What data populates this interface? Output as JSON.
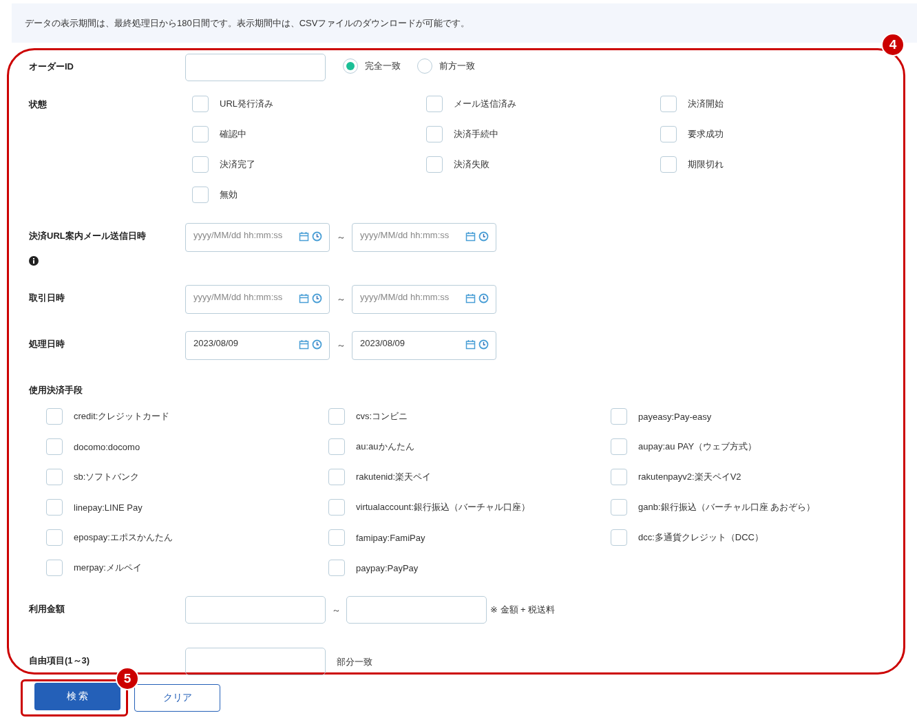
{
  "notice": "データの表示期間は、最終処理日から180日間です。表示期間中は、CSVファイルのダウンロードが可能です。",
  "callouts": [
    "4",
    "5"
  ],
  "order_id": {
    "label": "オーダーID",
    "match_options": [
      {
        "label": "完全一致",
        "selected": true
      },
      {
        "label": "前方一致",
        "selected": false
      }
    ]
  },
  "status": {
    "label": "状態",
    "options": [
      {
        "label": "URL発行済み",
        "checked": false
      },
      {
        "label": "メール送信済み",
        "checked": false
      },
      {
        "label": "決済開始",
        "checked": false
      },
      {
        "label": "確認中",
        "checked": false
      },
      {
        "label": "決済手続中",
        "checked": false
      },
      {
        "label": "要求成功",
        "checked": false
      },
      {
        "label": "決済完了",
        "checked": false
      },
      {
        "label": "決済失敗",
        "checked": false
      },
      {
        "label": "期限切れ",
        "checked": false
      },
      {
        "label": "無効",
        "checked": false
      }
    ]
  },
  "date_ranges": [
    {
      "label": "決済URL案内メール送信日時",
      "info": true,
      "from": {
        "placeholder": "yyyy/MM/dd hh:mm:ss"
      },
      "separator": "～",
      "to": {
        "placeholder": "yyyy/MM/dd hh:mm:ss"
      }
    },
    {
      "label": "取引日時",
      "info": false,
      "from": {
        "placeholder": "yyyy/MM/dd hh:mm:ss"
      },
      "separator": "～",
      "to": {
        "placeholder": "yyyy/MM/dd hh:mm:ss"
      }
    },
    {
      "label": "処理日時",
      "info": false,
      "from": {
        "value": "2023/08/09"
      },
      "separator": "～",
      "to": {
        "value": "2023/08/09"
      }
    }
  ],
  "payment_methods": {
    "label": "使用決済手段",
    "options": [
      {
        "label": "credit:クレジットカード",
        "checked": false
      },
      {
        "label": "cvs:コンビニ",
        "checked": false
      },
      {
        "label": "payeasy:Pay-easy",
        "checked": false
      },
      {
        "label": "docomo:docomo",
        "checked": false
      },
      {
        "label": "au:auかんたん",
        "checked": false
      },
      {
        "label": "aupay:au PAY（ウェブ方式）",
        "checked": false
      },
      {
        "label": "sb:ソフトバンク",
        "checked": false
      },
      {
        "label": "rakutenid:楽天ペイ",
        "checked": false
      },
      {
        "label": "rakutenpayv2:楽天ペイV2",
        "checked": false
      },
      {
        "label": "linepay:LINE Pay",
        "checked": false
      },
      {
        "label": "virtualaccount:銀行振込（バーチャル口座）",
        "checked": false
      },
      {
        "label": "ganb:銀行振込（バーチャル口座 あおぞら）",
        "checked": false
      },
      {
        "label": "epospay:エポスかんたん",
        "checked": false
      },
      {
        "label": "famipay:FamiPay",
        "checked": false
      },
      {
        "label": "dcc:多通貨クレジット（DCC）",
        "checked": false
      },
      {
        "label": "merpay:メルペイ",
        "checked": false
      },
      {
        "label": "paypay:PayPay",
        "checked": false
      }
    ]
  },
  "amount": {
    "label": "利用金額",
    "separator": "～",
    "note": "※ 金額 + 税送料"
  },
  "free_item": {
    "label": "自由項目(1～3)",
    "note": "部分一致"
  },
  "buttons": [
    {
      "label": "検 索",
      "kind": "primary"
    },
    {
      "label": "クリア",
      "kind": "secondary"
    }
  ]
}
